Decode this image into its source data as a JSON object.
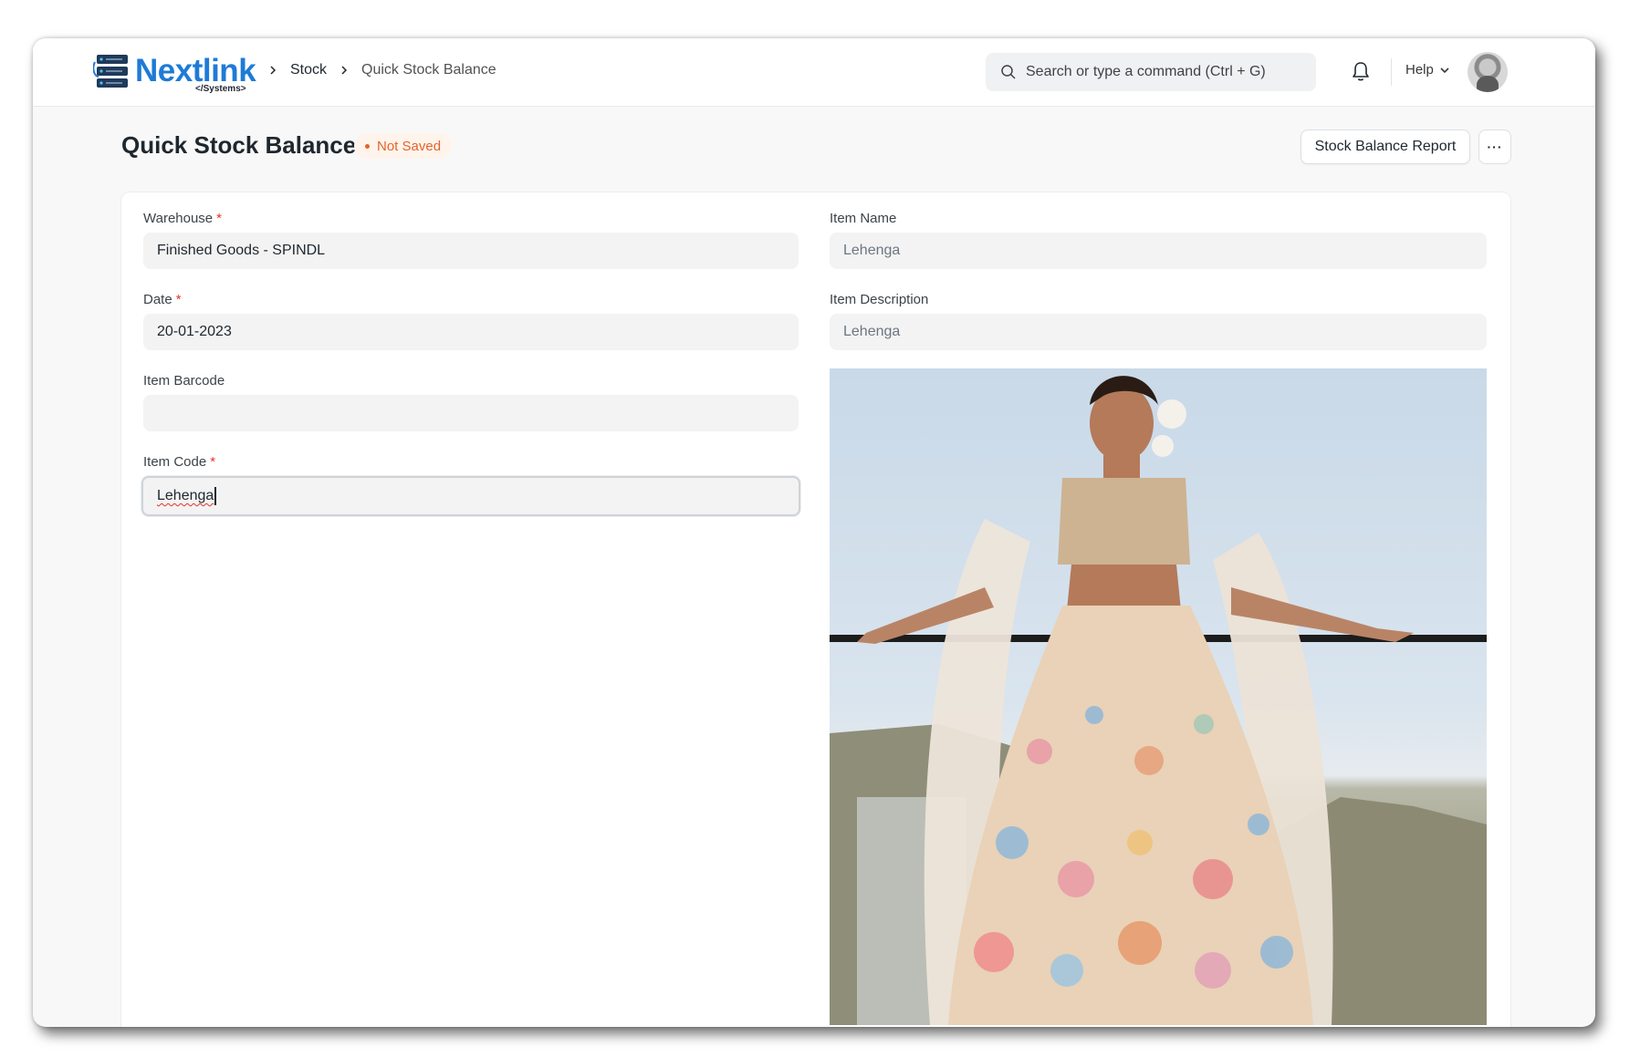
{
  "brand": {
    "name": "Nextlink",
    "sub": "</Systems>"
  },
  "breadcrumb": [
    "Stock",
    "Quick Stock Balance"
  ],
  "search": {
    "placeholder": "Search or type a command (Ctrl + G)"
  },
  "help_label": "Help",
  "page": {
    "title": "Quick Stock Balance",
    "status": "Not Saved"
  },
  "actions": {
    "report_label": "Stock Balance Report",
    "more_label": "···"
  },
  "form": {
    "warehouse": {
      "label": "Warehouse",
      "value": "Finished Goods - SPINDL",
      "required": "*"
    },
    "date": {
      "label": "Date",
      "value": "20-01-2023",
      "required": "*"
    },
    "item_barcode": {
      "label": "Item Barcode",
      "value": ""
    },
    "item_code": {
      "label": "Item Code",
      "value": "Lehenga",
      "required": "*"
    },
    "item_name": {
      "label": "Item Name",
      "value": "Lehenga"
    },
    "item_description": {
      "label": "Item Description",
      "value": "Lehenga"
    }
  },
  "colors": {
    "brand_blue": "#1e7bd6",
    "badge_orange": "#e5632a",
    "required_red": "#e5342a"
  },
  "icons": [
    "server-logo-icon",
    "chevron-right-icon",
    "search-icon",
    "bell-icon",
    "chevron-down-icon",
    "user-avatar-icon"
  ]
}
